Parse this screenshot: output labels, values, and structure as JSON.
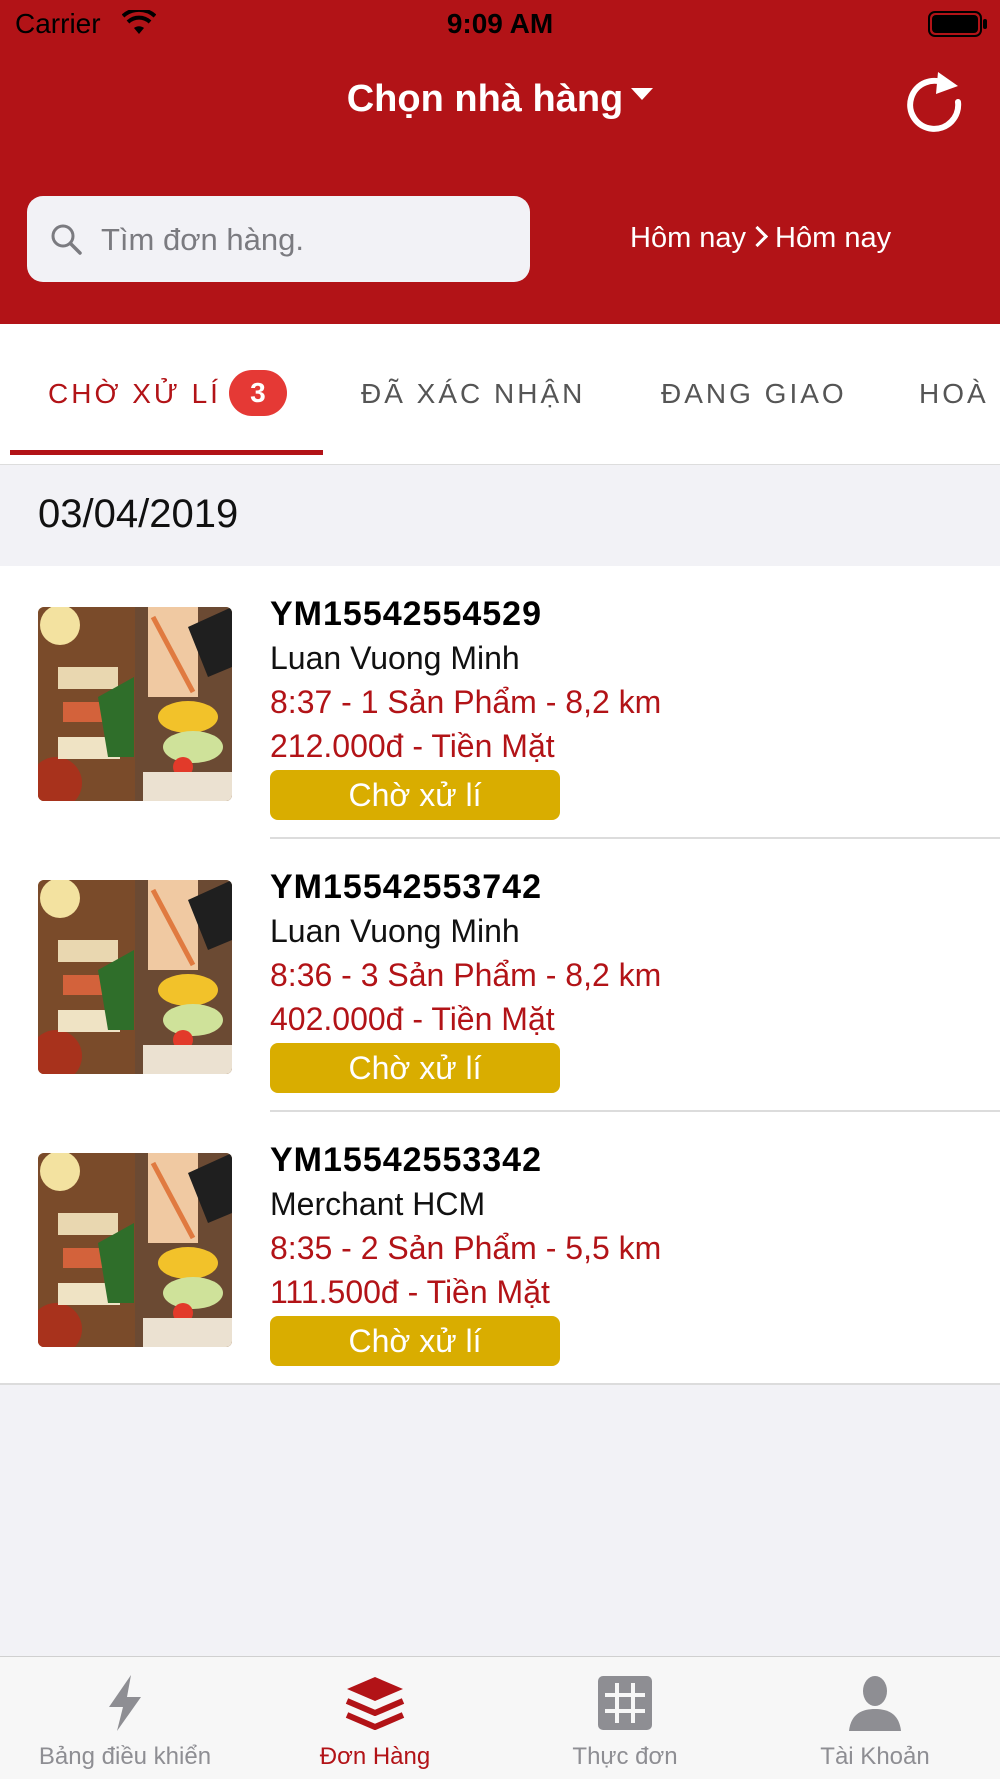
{
  "status_bar": {
    "carrier": "Carrier",
    "time": "9:09 AM"
  },
  "header": {
    "title": "Chọn nhà hàng",
    "search_placeholder": "Tìm đơn hàng.",
    "date_from": "Hôm nay",
    "date_to": "Hôm nay"
  },
  "tabs": [
    {
      "label": "CHỜ XỬ LÍ",
      "badge": "3",
      "active": true
    },
    {
      "label": "ĐÃ XÁC NHẬN"
    },
    {
      "label": "ĐANG GIAO"
    },
    {
      "label": "HOÀ"
    }
  ],
  "section_date": "03/04/2019",
  "orders": [
    {
      "id": "YM15542554529",
      "customer": "Luan Vuong Minh",
      "summary": "8:37 - 1 Sản Phẩm - 8,2 km",
      "payment": "212.000đ - Tiền Mặt",
      "status": "Chờ xử lí"
    },
    {
      "id": "YM15542553742",
      "customer": "Luan Vuong Minh",
      "summary": "8:36 - 3 Sản Phẩm - 8,2 km",
      "payment": "402.000đ - Tiền Mặt",
      "status": "Chờ xử lí"
    },
    {
      "id": "YM15542553342",
      "customer": "Merchant HCM",
      "summary": "8:35 - 2 Sản Phẩm - 5,5 km",
      "payment": "111.500đ - Tiền Mặt",
      "status": "Chờ xử lí"
    }
  ],
  "tabbar": [
    {
      "label": "Bảng điều khiển",
      "icon": "lightning-icon"
    },
    {
      "label": "Đơn Hàng",
      "icon": "layers-icon",
      "active": true
    },
    {
      "label": "Thực đơn",
      "icon": "grid-icon"
    },
    {
      "label": "Tài Khoản",
      "icon": "user-icon"
    }
  ],
  "colors": {
    "brand": "#b21317",
    "status_pending": "#d9ad00",
    "badge": "#e53935"
  }
}
